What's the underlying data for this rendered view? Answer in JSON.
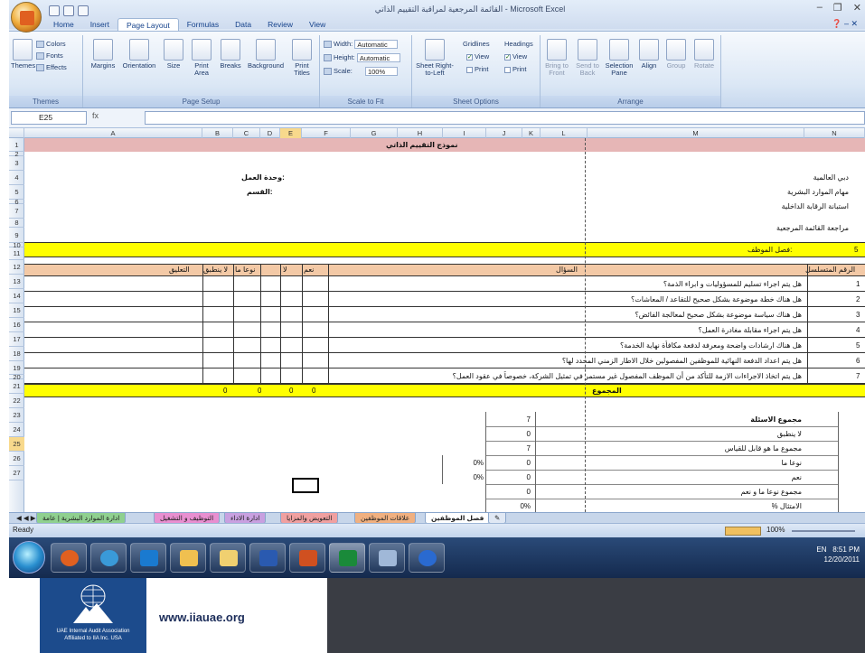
{
  "window": {
    "title": "القائمة المرجعية لمراقبة التقييم الذاتي - Microsoft Excel"
  },
  "tabs": [
    "Home",
    "Insert",
    "Page Layout",
    "Formulas",
    "Data",
    "Review",
    "View"
  ],
  "ribbon": {
    "themes": {
      "label": "Themes",
      "btn": "Themes",
      "colors": "Colors",
      "fonts": "Fonts",
      "effects": "Effects"
    },
    "page_setup": {
      "label": "Page Setup",
      "margins": "Margins",
      "orientation": "Orientation",
      "size": "Size",
      "print_area": "Print Area",
      "breaks": "Breaks",
      "background": "Background",
      "print_titles": "Print Titles"
    },
    "scale": {
      "label": "Scale to Fit",
      "width": "Width:",
      "width_val": "Automatic",
      "height": "Height:",
      "height_val": "Automatic",
      "scale": "Scale:",
      "scale_val": "100%"
    },
    "sheet_options": {
      "label": "Sheet Options",
      "sheet_rtl": "Sheet Right-to-Left",
      "gridlines": "Gridlines",
      "headings": "Headings",
      "view": "View",
      "print": "Print"
    },
    "arrange": {
      "label": "Arrange",
      "bring": "Bring to Front",
      "send": "Send to Back",
      "selection": "Selection Pane",
      "align": "Align",
      "group": "Group",
      "rotate": "Rotate"
    }
  },
  "namebox": "E25",
  "fx": "fx",
  "columns": [
    "A",
    "B",
    "C",
    "D",
    "E",
    "F",
    "G",
    "H",
    "I",
    "J",
    "K",
    "L",
    "M",
    "N"
  ],
  "rows": [
    "1",
    "2",
    "3",
    "4",
    "5",
    "6",
    "7",
    "8",
    "9",
    "10",
    "11",
    "12",
    "13",
    "14",
    "15",
    "16",
    "17",
    "18",
    "19",
    "20",
    "21",
    "22",
    "23",
    "24",
    "25",
    "26",
    "27"
  ],
  "sheet": {
    "form_title": "نموذج التقييم الذاتي",
    "org": "دبي العالمية",
    "dept": "مهام الموارد البشرية",
    "survey": "استبانة الرقابة الداخلية",
    "review": "مراجعة القائمة المرجعية",
    "unit": "وحدة العمل:",
    "section": "القسم:",
    "chapter_label": "فصل الموظف:",
    "chapter_num": "5",
    "headers": {
      "serial": "الرقم المتسلسل",
      "question": "السؤال",
      "yes": "نعم",
      "no": "لا",
      "somewhat": "نوعا ما",
      "na": "لا ينطبق",
      "comment": "التعليق"
    },
    "questions": [
      {
        "n": "1",
        "q": "هل يتم اجراء تسليم للمسؤوليات و ابراء الذمة؟"
      },
      {
        "n": "2",
        "q": "هل هناك خطة موضوعة بشكل صحيح للتقاعد / المعاشات؟"
      },
      {
        "n": "3",
        "q": "هل هناك سياسة موضوعة بشكل صحيح لمعالجة الفائض؟"
      },
      {
        "n": "4",
        "q": "هل يتم اجراء مقابلة مغادرة العمل؟"
      },
      {
        "n": "5",
        "q": "هل هناك ارشادات واضحة ومعرفة لدفعة مكافأة نهاية الخدمة؟"
      },
      {
        "n": "6",
        "q": "هل يتم اعداد الدفعة النهائية للموظفين المفصولين خلال الاطار الزمني المحدد لها؟"
      },
      {
        "n": "7",
        "q": "هل يتم اتخاذ الاجراءات الازمة للتأكد من أن الموظف المفصول غير مستمر في تمثيل الشركة، خصوصاً في عقود العمل؟"
      }
    ],
    "total_label": "المجموع",
    "totals": [
      "0",
      "0",
      "0",
      "0"
    ],
    "summary": [
      {
        "label": "مجموع الاسئلة",
        "v1": "7",
        "v2": ""
      },
      {
        "label": "لا ينطبق",
        "v1": "0",
        "v2": ""
      },
      {
        "label": "مجموع ما هو قابل للقياس",
        "v1": "7",
        "v2": ""
      },
      {
        "label": "نوعا ما",
        "v1": "0",
        "v2": "0%"
      },
      {
        "label": "نعم",
        "v1": "0",
        "v2": "0%"
      },
      {
        "label": "مجموع نوعا ما و نعم",
        "v1": "0",
        "v2": ""
      },
      {
        "label": "الامتثال %",
        "v1": "0%",
        "v2": ""
      }
    ]
  },
  "sheet_tabs": [
    "فصل الموظفين",
    "علاقات الموظفين",
    "التعويض والمزايا",
    "ادارة الاداء",
    "التوظيف و التشغيل",
    "ادارة الموارد البشرية | عامة"
  ],
  "status": {
    "ready": "Ready",
    "zoom": "100%"
  },
  "tray": {
    "lang": "EN",
    "time": "8:51 PM",
    "date": "12/20/2011"
  },
  "footer": {
    "url": "www.iiauae.org",
    "logo_text": "IIA",
    "org_line1": "UAE Internal Audit Association",
    "org_line2": "Affiliated to IIA Inc. USA"
  },
  "colors": {
    "pink_band": "#e6b6b6",
    "yellow_band": "#ffff00",
    "header_band": "#f3c9a6",
    "selection": "#f8d98c"
  }
}
